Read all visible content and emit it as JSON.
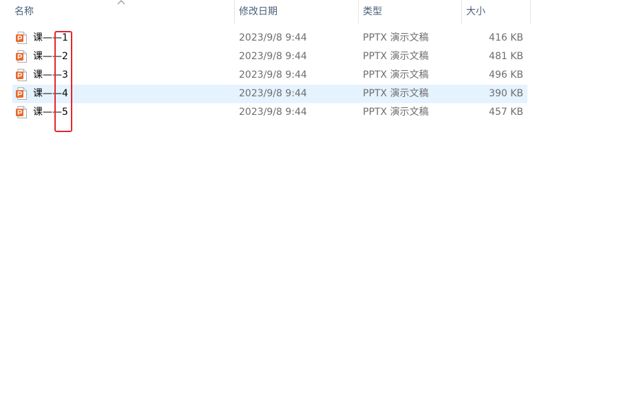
{
  "columns": {
    "name": "名称",
    "date": "修改日期",
    "type": "类型",
    "size": "大小"
  },
  "sort": {
    "column": "name",
    "direction": "ascending",
    "icon": "chevron-up-icon"
  },
  "files": [
    {
      "name": "课——1",
      "date": "2023/9/8 9:44",
      "type": "PPTX 演示文稿",
      "size": "416 KB",
      "icon": "pptx-file-icon",
      "selected": false
    },
    {
      "name": "课——2",
      "date": "2023/9/8 9:44",
      "type": "PPTX 演示文稿",
      "size": "481 KB",
      "icon": "pptx-file-icon",
      "selected": false
    },
    {
      "name": "课——3",
      "date": "2023/9/8 9:44",
      "type": "PPTX 演示文稿",
      "size": "496 KB",
      "icon": "pptx-file-icon",
      "selected": false
    },
    {
      "name": "课——4",
      "date": "2023/9/8 9:44",
      "type": "PPTX 演示文稿",
      "size": "390 KB",
      "icon": "pptx-file-icon",
      "selected": true
    },
    {
      "name": "课——5",
      "date": "2023/9/8 9:44",
      "type": "PPTX 演示文稿",
      "size": "457 KB",
      "icon": "pptx-file-icon",
      "selected": false
    }
  ],
  "colors": {
    "selection": "#e5f3ff",
    "annotation": "#e0272a",
    "pptx_icon": "#e8692c"
  }
}
